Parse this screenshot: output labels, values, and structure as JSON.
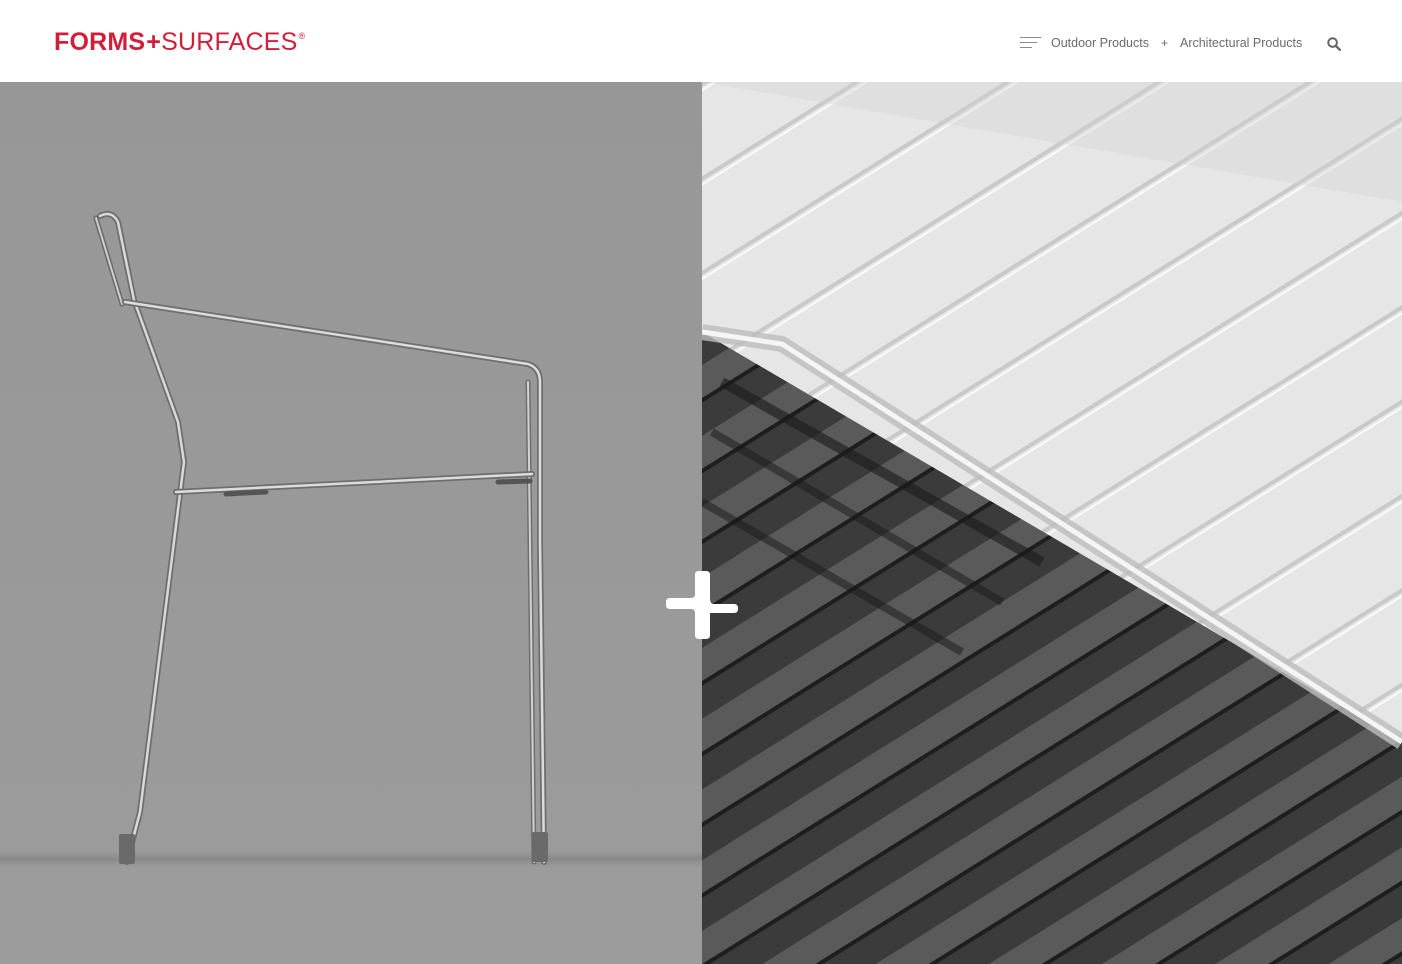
{
  "header": {
    "logo": {
      "forms": "FORMS",
      "plus": "+",
      "surfaces": "SURFACES",
      "registered": "®",
      "brand_color": "#d11f3a"
    },
    "nav": {
      "menu_icon": "hamburger-menu-icon",
      "links": [
        {
          "label": "Outdoor Products"
        },
        {
          "label": "Architectural Products"
        }
      ],
      "separator": "+",
      "search_icon": "search-icon"
    }
  },
  "hero": {
    "left_panel": {
      "subject": "chair-image"
    },
    "right_panel": {
      "subject": "glass-panel-image"
    },
    "center_icon": "plus-icon"
  }
}
